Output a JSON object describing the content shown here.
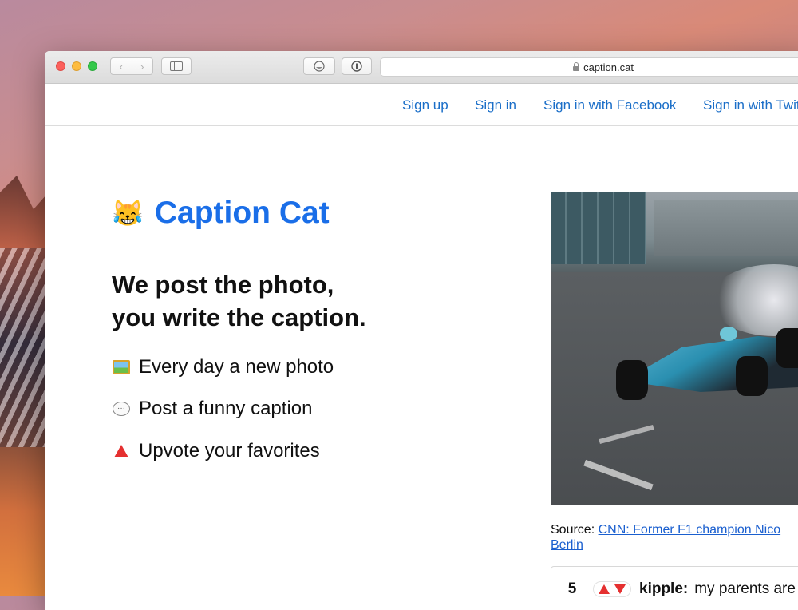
{
  "browser": {
    "url": "caption.cat"
  },
  "nav": {
    "links": [
      "Sign up",
      "Sign in",
      "Sign in with Facebook",
      "Sign in with Twitter"
    ]
  },
  "hero": {
    "emoji": "😹",
    "title": "Caption Cat",
    "tagline_line1": "We post the photo,",
    "tagline_line2": "you write the caption."
  },
  "features": [
    {
      "icon": "framed-picture-icon",
      "text": "Every day a new photo"
    },
    {
      "icon": "speech-balloon-icon",
      "text": "Post a funny caption"
    },
    {
      "icon": "red-up-triangle-icon",
      "text": "Upvote your favorites"
    }
  ],
  "photo": {
    "source_label": "Source:",
    "source_link_text": "CNN: Former F1 champion Nico",
    "source_link_text2": "Berlin"
  },
  "caption": {
    "score": "5",
    "user": "kipple:",
    "text": "my parents are"
  },
  "colors": {
    "brand_blue": "#1a6ee8",
    "link_blue": "#1a6ec8",
    "vote_red": "#e53030"
  }
}
